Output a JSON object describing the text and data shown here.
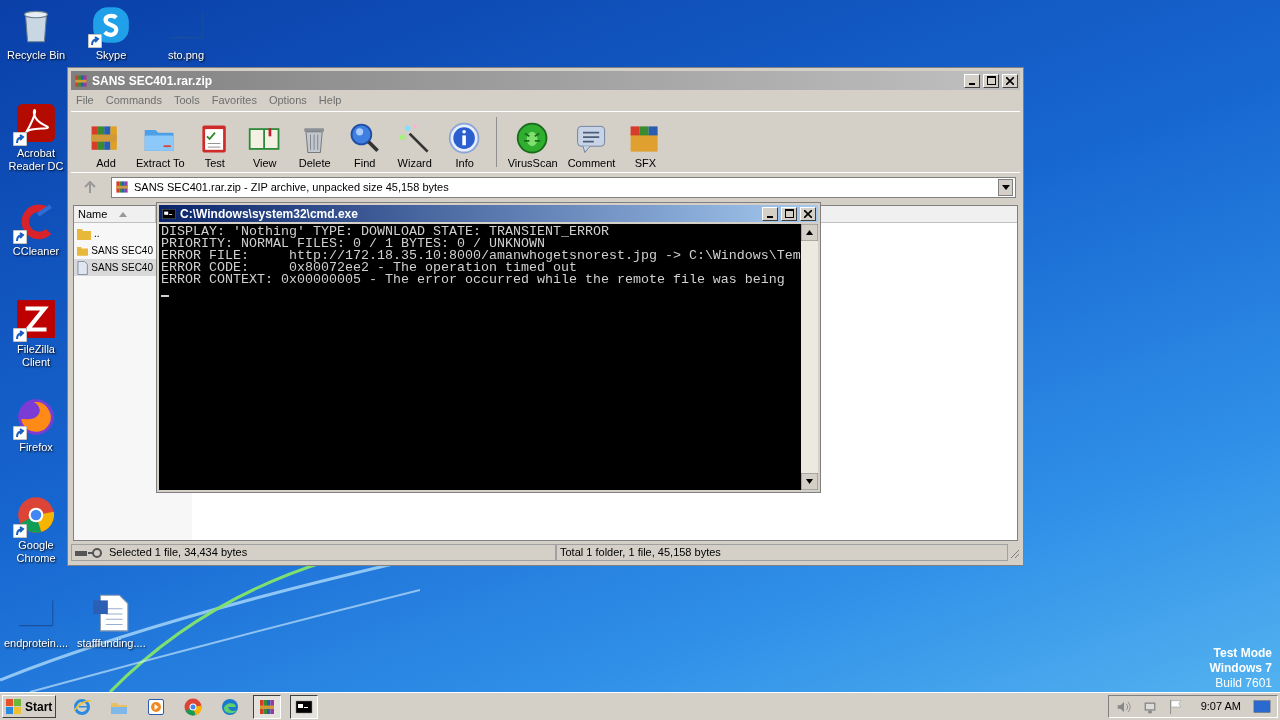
{
  "desktop_icons": [
    {
      "label": "Recycle Bin",
      "kind": "recycle",
      "shortcut": false
    },
    {
      "label": "Skype",
      "kind": "skype",
      "shortcut": true
    },
    {
      "label": "sto.png",
      "kind": "blank",
      "shortcut": false
    },
    {
      "label": "Acrobat Reader DC",
      "kind": "acrobat",
      "shortcut": true
    },
    {
      "label": "CCleaner",
      "kind": "ccleaner",
      "shortcut": true
    },
    {
      "label": "FileZilla Client",
      "kind": "filezilla",
      "shortcut": true
    },
    {
      "label": "Firefox",
      "kind": "firefox",
      "shortcut": true
    },
    {
      "label": "Google Chrome",
      "kind": "chrome",
      "shortcut": true
    },
    {
      "label": "endprotein....",
      "kind": "blank",
      "shortcut": false
    },
    {
      "label": "stafffunding....",
      "kind": "word",
      "shortcut": false
    }
  ],
  "archive_window": {
    "title": "SANS SEC401.rar.zip",
    "menu": [
      "File",
      "Commands",
      "Tools",
      "Favorites",
      "Options",
      "Help"
    ],
    "toolbar": [
      {
        "label": "Add",
        "kind": "add"
      },
      {
        "label": "Extract To",
        "kind": "extract"
      },
      {
        "label": "Test",
        "kind": "test"
      },
      {
        "label": "View",
        "kind": "view"
      },
      {
        "label": "Delete",
        "kind": "delete"
      },
      {
        "label": "Find",
        "kind": "find"
      },
      {
        "label": "Wizard",
        "kind": "wizard"
      },
      {
        "label": "Info",
        "kind": "info"
      },
      {
        "label": "VirusScan",
        "kind": "virus"
      },
      {
        "label": "Comment",
        "kind": "comment"
      },
      {
        "label": "SFX",
        "kind": "sfx"
      }
    ],
    "path": "SANS SEC401.rar.zip - ZIP archive, unpacked size 45,158 bytes",
    "column": "Name",
    "files": [
      {
        "name": "..",
        "kind": "folder",
        "selected": false
      },
      {
        "name": "SANS SEC40",
        "kind": "folder",
        "selected": false
      },
      {
        "name": "SANS SEC40",
        "kind": "file",
        "selected": true
      }
    ],
    "status_left": "Selected 1 file, 34,434 bytes",
    "status_right": "Total 1 folder, 1 file, 45,158 bytes"
  },
  "console": {
    "title": "C:\\Windows\\system32\\cmd.exe",
    "lines": [
      "DISPLAY: 'Nothing' TYPE: DOWNLOAD STATE: TRANSIENT_ERROR",
      "PRIORITY: NORMAL FILES: 0 / 1 BYTES: 0 / UNKNOWN",
      "ERROR FILE:     http://172.18.35.10:8000/amanwhogetsnorest.jpg -> C:\\Windows\\Tem",
      "ERROR CODE:     0x80072ee2 - The operation timed out",
      "ERROR CONTEXT: 0x00000005 - The error occurred while the remote file was being"
    ]
  },
  "os_notice": [
    "Test Mode",
    "Windows 7",
    "Build 7601"
  ],
  "taskbar": {
    "start": "Start",
    "apps": [
      {
        "kind": "ie",
        "active": false
      },
      {
        "kind": "explorer",
        "active": false
      },
      {
        "kind": "media",
        "active": false
      },
      {
        "kind": "chrome",
        "active": false
      },
      {
        "kind": "edge",
        "active": false
      },
      {
        "kind": "winrar",
        "active": true
      },
      {
        "kind": "cmd",
        "active": true
      }
    ],
    "tray": [
      {
        "kind": "speaker"
      },
      {
        "kind": "network"
      },
      {
        "kind": "flag"
      }
    ],
    "clock": "9:07 AM"
  }
}
